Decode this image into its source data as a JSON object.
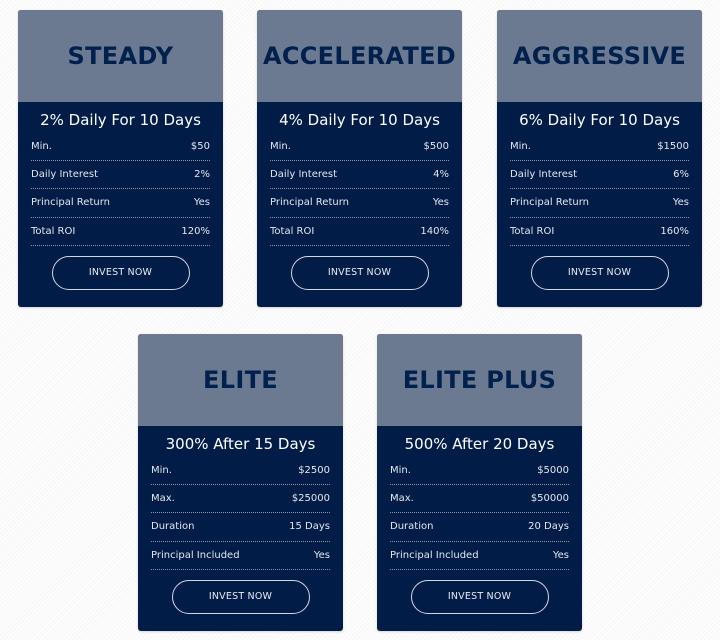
{
  "colors": {
    "header_bg": "#6b7a90",
    "body_bg": "#001c47",
    "title_text": "#00204e"
  },
  "plans": [
    {
      "name": "STEADY",
      "headline": "2% Daily For 10 Days",
      "rows": [
        {
          "label": "Min.",
          "value": "$50"
        },
        {
          "label": "Daily Interest",
          "value": "2%"
        },
        {
          "label": "Principal Return",
          "value": "Yes"
        },
        {
          "label": "Total ROI",
          "value": "120%"
        }
      ],
      "button": "INVEST NOW"
    },
    {
      "name": "ACCELERATED",
      "headline": "4% Daily For 10 Days",
      "rows": [
        {
          "label": "Min.",
          "value": "$500"
        },
        {
          "label": "Daily Interest",
          "value": "4%"
        },
        {
          "label": "Principal Return",
          "value": "Yes"
        },
        {
          "label": "Total ROI",
          "value": "140%"
        }
      ],
      "button": "INVEST NOW"
    },
    {
      "name": "AGGRESSIVE",
      "headline": "6% Daily For 10 Days",
      "rows": [
        {
          "label": "Min.",
          "value": "$1500"
        },
        {
          "label": "Daily Interest",
          "value": "6%"
        },
        {
          "label": "Principal Return",
          "value": "Yes"
        },
        {
          "label": "Total ROI",
          "value": "160%"
        }
      ],
      "button": "INVEST NOW"
    },
    {
      "name": "ELITE",
      "headline": "300% After 15 Days",
      "rows": [
        {
          "label": "Min.",
          "value": "$2500"
        },
        {
          "label": "Max.",
          "value": "$25000"
        },
        {
          "label": "Duration",
          "value": "15 Days"
        },
        {
          "label": "Principal Included",
          "value": "Yes"
        }
      ],
      "button": "INVEST NOW"
    },
    {
      "name": "ELITE PLUS",
      "headline": "500% After 20 Days",
      "rows": [
        {
          "label": "Min.",
          "value": "$5000"
        },
        {
          "label": "Max.",
          "value": "$50000"
        },
        {
          "label": "Duration",
          "value": "20 Days"
        },
        {
          "label": "Principal Included",
          "value": "Yes"
        }
      ],
      "button": "INVEST NOW"
    }
  ]
}
